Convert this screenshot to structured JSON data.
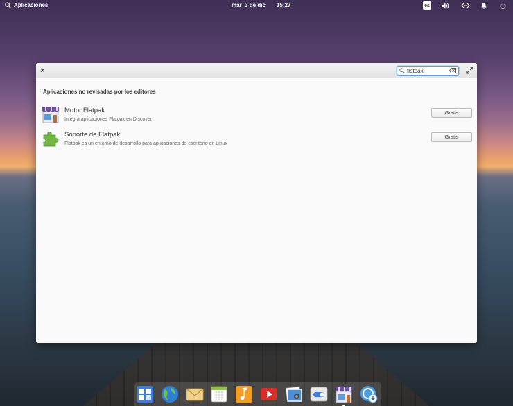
{
  "panel": {
    "applications_label": "Aplicaciones",
    "date": "mar  3 de dic",
    "time": "15:27",
    "keyboard_layout": "es"
  },
  "window": {
    "search_value": "flatpak",
    "section_title": "Aplicaciones no revisadas por los editores",
    "apps": [
      {
        "name": "Motor Flatpak",
        "description": "Integra aplicaciones Flatpak en Discover",
        "button": "Gratis"
      },
      {
        "name": "Soporte de Flatpak",
        "description": "Flatpak es un entorno de desarrollo para aplicaciones de escritorio en Linux",
        "button": "Gratis"
      }
    ]
  },
  "dock": {
    "items": [
      "multitasking-view-icon",
      "web-browser-icon",
      "mail-icon",
      "calendar-icon",
      "music-icon",
      "videos-icon",
      "photos-icon",
      "system-settings-icon",
      "appcenter-icon",
      "update-icon"
    ]
  },
  "colors": {
    "accent": "#5b9ed9",
    "window_bg": "#fafafa"
  }
}
